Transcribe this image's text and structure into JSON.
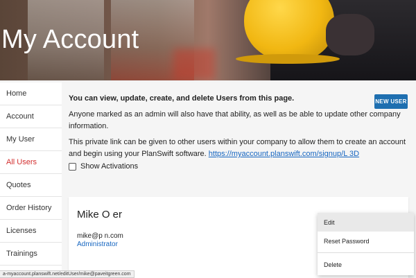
{
  "header": {
    "title": "My Account"
  },
  "sidebar": {
    "items": [
      {
        "label": "Home"
      },
      {
        "label": "Account"
      },
      {
        "label": "My User"
      },
      {
        "label": "All Users",
        "active": true
      },
      {
        "label": "Quotes"
      },
      {
        "label": "Order History"
      },
      {
        "label": "Licenses"
      },
      {
        "label": "Trainings"
      }
    ]
  },
  "main": {
    "intro_bold": "You can view, update, create, and delete Users from this page.",
    "intro_admin": "Anyone marked as an admin will also have that ability, as well as be able to update other company information.",
    "intro_link_text": "This private link can be given to other users within your company to allow them to create an account and begin using your PlanSwift software. ",
    "signup_link": "https://myaccount.planswift.com/signup/L       3D",
    "new_user_label": "NEW USER",
    "show_activations_label": "Show Activations"
  },
  "user_card": {
    "name": "Mike O           er",
    "email": "mike@p            n.com",
    "role": "Administrator"
  },
  "context_menu": {
    "edit": "Edit",
    "reset_password": "Reset Password",
    "delete": "Delete"
  },
  "status_bar": {
    "url": "a-myaccount.planswift.net/editUser/mike@paveitgreen.com"
  },
  "colors": {
    "accent_blue": "#1e6fb0",
    "active_red": "#d32f2f",
    "link_blue": "#1565c0"
  }
}
